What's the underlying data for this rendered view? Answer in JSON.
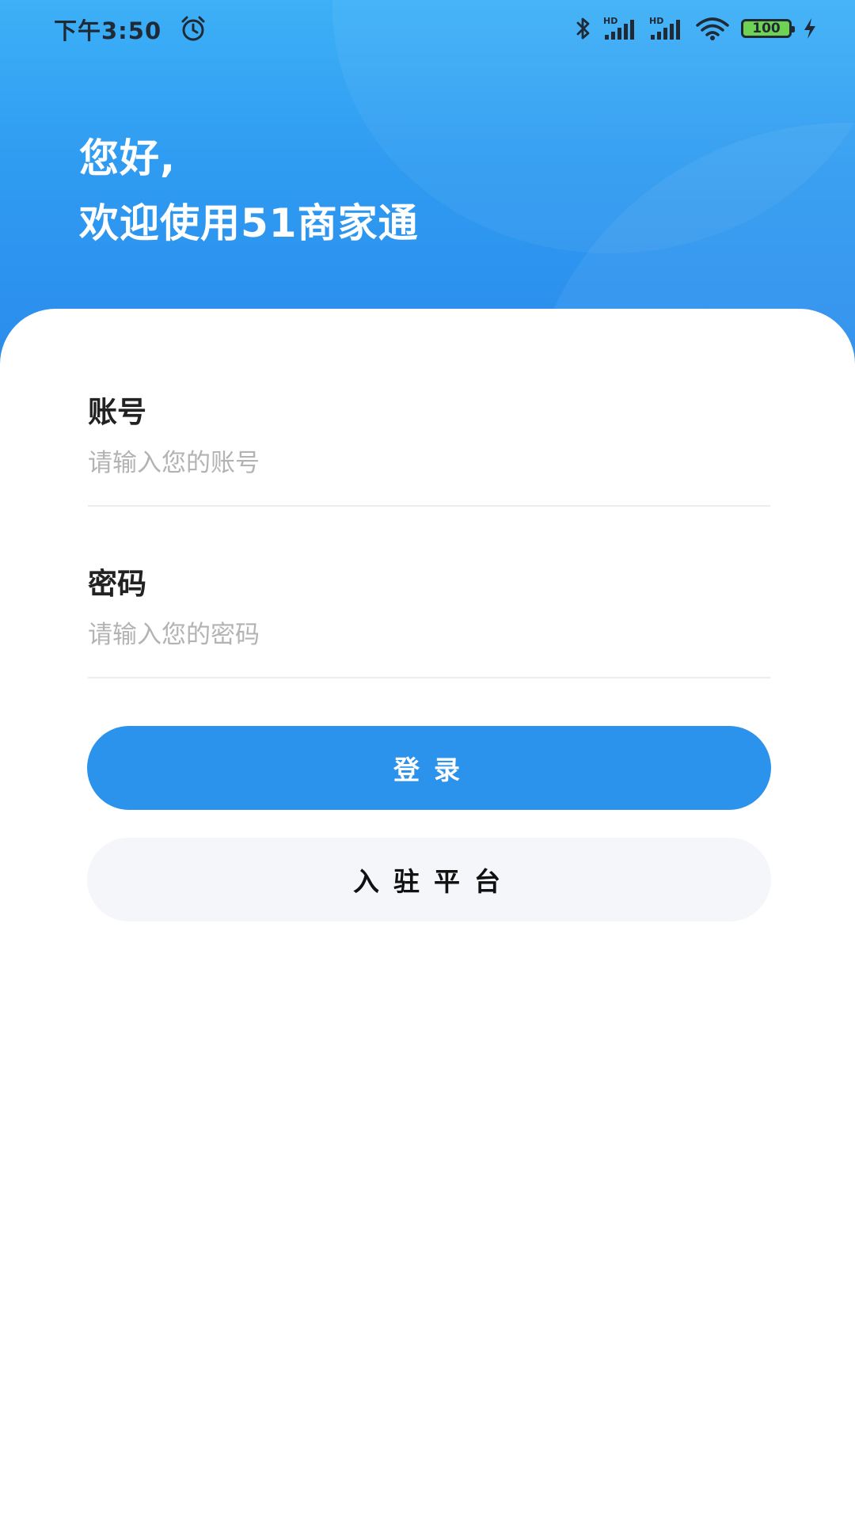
{
  "status_bar": {
    "time": "下午3:50",
    "battery": "100",
    "icons": [
      "alarm-icon",
      "bluetooth-icon",
      "signal-hd-icon",
      "signal-hd-icon",
      "wifi-icon",
      "battery-icon",
      "charging-icon"
    ]
  },
  "header": {
    "greeting_line1": "您好,",
    "greeting_line2": "欢迎使用51商家通"
  },
  "form": {
    "account_label": "账号",
    "account_placeholder": "请输入您的账号",
    "password_label": "密码",
    "password_placeholder": "请输入您的密码"
  },
  "buttons": {
    "login": "登录",
    "join_platform": "入驻平台"
  },
  "colors": {
    "header_gradient_top": "#3db0f7",
    "header_gradient_bottom": "#2a8cec",
    "primary": "#2c93ec",
    "secondary_button_bg": "#f4f6fa"
  }
}
